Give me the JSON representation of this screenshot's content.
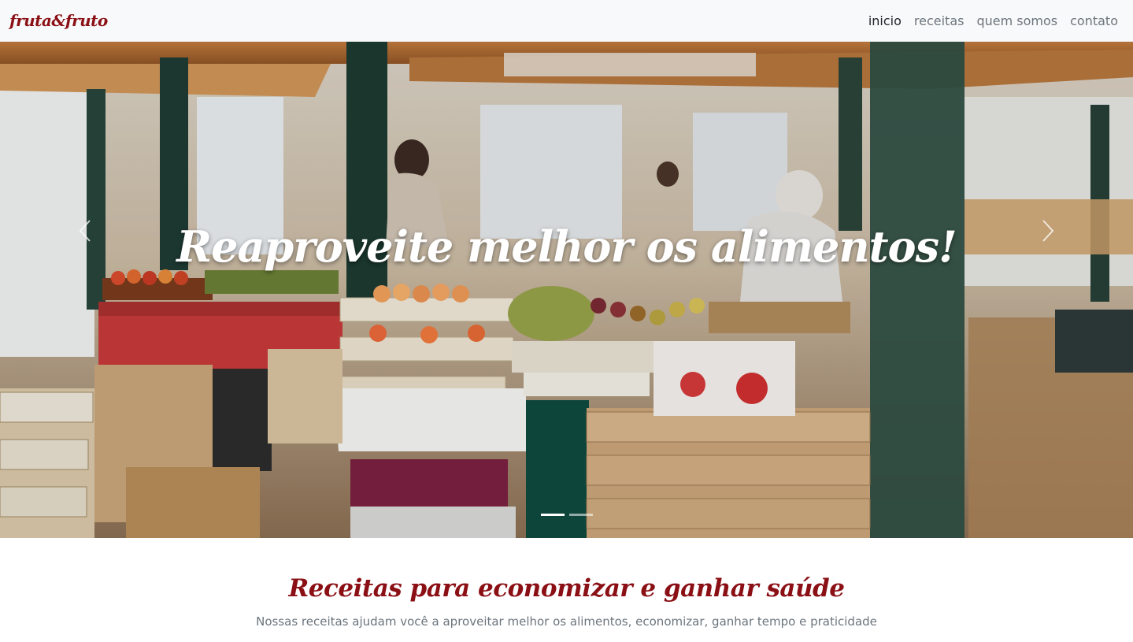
{
  "navbar": {
    "brand": "fruta&fruto",
    "links": [
      {
        "label": "inicio",
        "active": true
      },
      {
        "label": "receitas",
        "active": false
      },
      {
        "label": "quem somos",
        "active": false
      },
      {
        "label": "contato",
        "active": false
      }
    ]
  },
  "hero": {
    "title": "Reaproveite melhor os alimentos!",
    "prev_icon": "chevron-left-icon",
    "next_icon": "chevron-right-icon",
    "indicator_count": 2,
    "active_indicator": 0
  },
  "section": {
    "title": "Receitas para economizar e ganhar saúde",
    "subtitle": "Nossas receitas ajudam você a aproveitar melhor os alimentos, economizar, ganhar tempo e praticidade"
  },
  "colors": {
    "brand": "#8b1015",
    "nav_bg": "#f8f9fa",
    "muted_text": "#6c757d"
  }
}
